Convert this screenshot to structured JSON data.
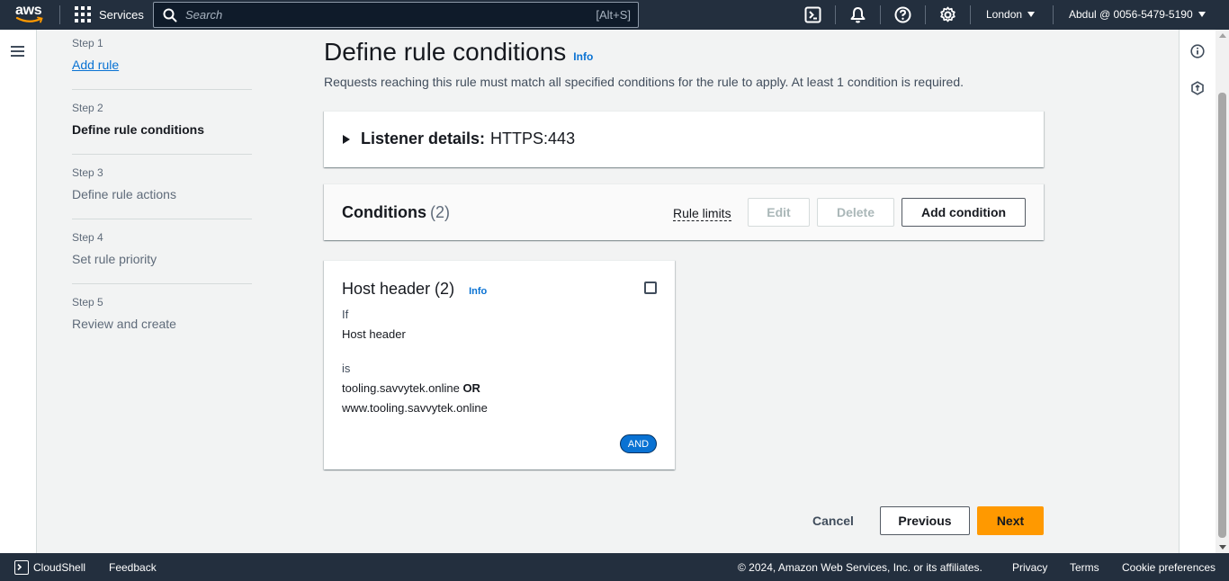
{
  "topnav": {
    "logo_text": "aws",
    "services_label": "Services",
    "search_placeholder": "Search",
    "search_shortcut": "[Alt+S]",
    "icons": [
      "cloudshell-icon",
      "bell-icon",
      "help-icon",
      "settings-icon"
    ],
    "region": "London",
    "account": "Abdul @ 0056-5479-5190"
  },
  "steps": [
    {
      "number": "Step 1",
      "title": "Add rule",
      "state": "link"
    },
    {
      "number": "Step 2",
      "title": "Define rule conditions",
      "state": "active"
    },
    {
      "number": "Step 3",
      "title": "Define rule actions",
      "state": "disabled"
    },
    {
      "number": "Step 4",
      "title": "Set rule priority",
      "state": "disabled"
    },
    {
      "number": "Step 5",
      "title": "Review and create",
      "state": "disabled"
    }
  ],
  "main": {
    "title": "Define rule conditions",
    "info": "Info",
    "description": "Requests reaching this rule must match all specified conditions for the rule to apply. At least 1 condition is required.",
    "listener": {
      "label": "Listener details:",
      "value": "HTTPS:443"
    },
    "conditions": {
      "title": "Conditions",
      "count": "(2)",
      "rule_limits": "Rule limits",
      "edit": "Edit",
      "delete": "Delete",
      "add": "Add condition"
    },
    "card": {
      "title": "Host header (2)",
      "info": "Info",
      "if_label": "If",
      "field": "Host header",
      "is_label": "is",
      "value1": "tooling.savvytek.online",
      "or_label": "OR",
      "value2": "www.tooling.savvytek.online",
      "badge": "AND"
    },
    "actions": {
      "cancel": "Cancel",
      "previous": "Previous",
      "next": "Next"
    }
  },
  "footer": {
    "cloudshell": "CloudShell",
    "feedback": "Feedback",
    "copyright": "© 2024, Amazon Web Services, Inc. or its affiliates.",
    "privacy": "Privacy",
    "terms": "Terms",
    "cookies": "Cookie preferences"
  },
  "colors": {
    "nav_bg": "#232f3e",
    "link": "#0972d3",
    "primary": "#ff9900",
    "page_bg": "#f2f3f3"
  }
}
